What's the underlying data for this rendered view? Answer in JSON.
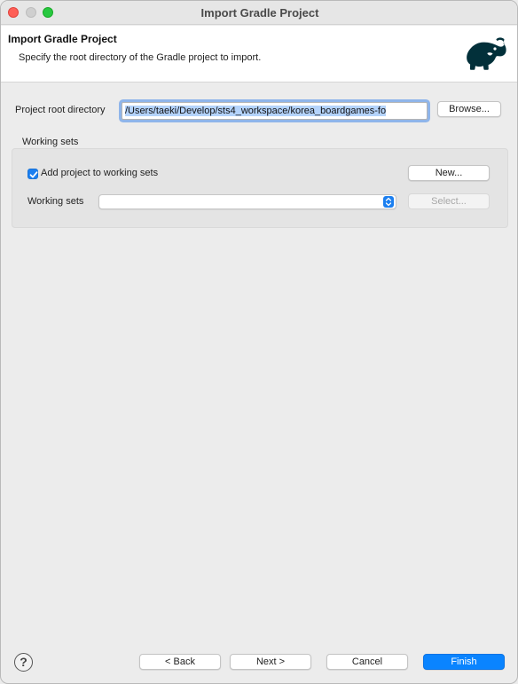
{
  "window": {
    "title": "Import Gradle Project"
  },
  "header": {
    "title": "Import Gradle Project",
    "description": "Specify the root directory of the Gradle project to import.",
    "logo_icon": "gradle-elephant-icon"
  },
  "project_root": {
    "label": "Project root directory",
    "value": "/Users/taeki/Develop/sts4_workspace/korea_boardgames-fo",
    "browse_label": "Browse..."
  },
  "working_sets": {
    "group_label": "Working sets",
    "add_checkbox_label": "Add project to working sets",
    "add_checked": true,
    "new_label": "New...",
    "sets_label": "Working sets",
    "sets_value": "",
    "select_label": "Select..."
  },
  "footer": {
    "help_icon": "help-icon",
    "help_glyph": "?",
    "back_label": "< Back",
    "next_label": "Next >",
    "cancel_label": "Cancel",
    "finish_label": "Finish"
  },
  "colors": {
    "accent": "#0a84ff",
    "selection": "#b4d3fb",
    "logo": "#02303a"
  }
}
